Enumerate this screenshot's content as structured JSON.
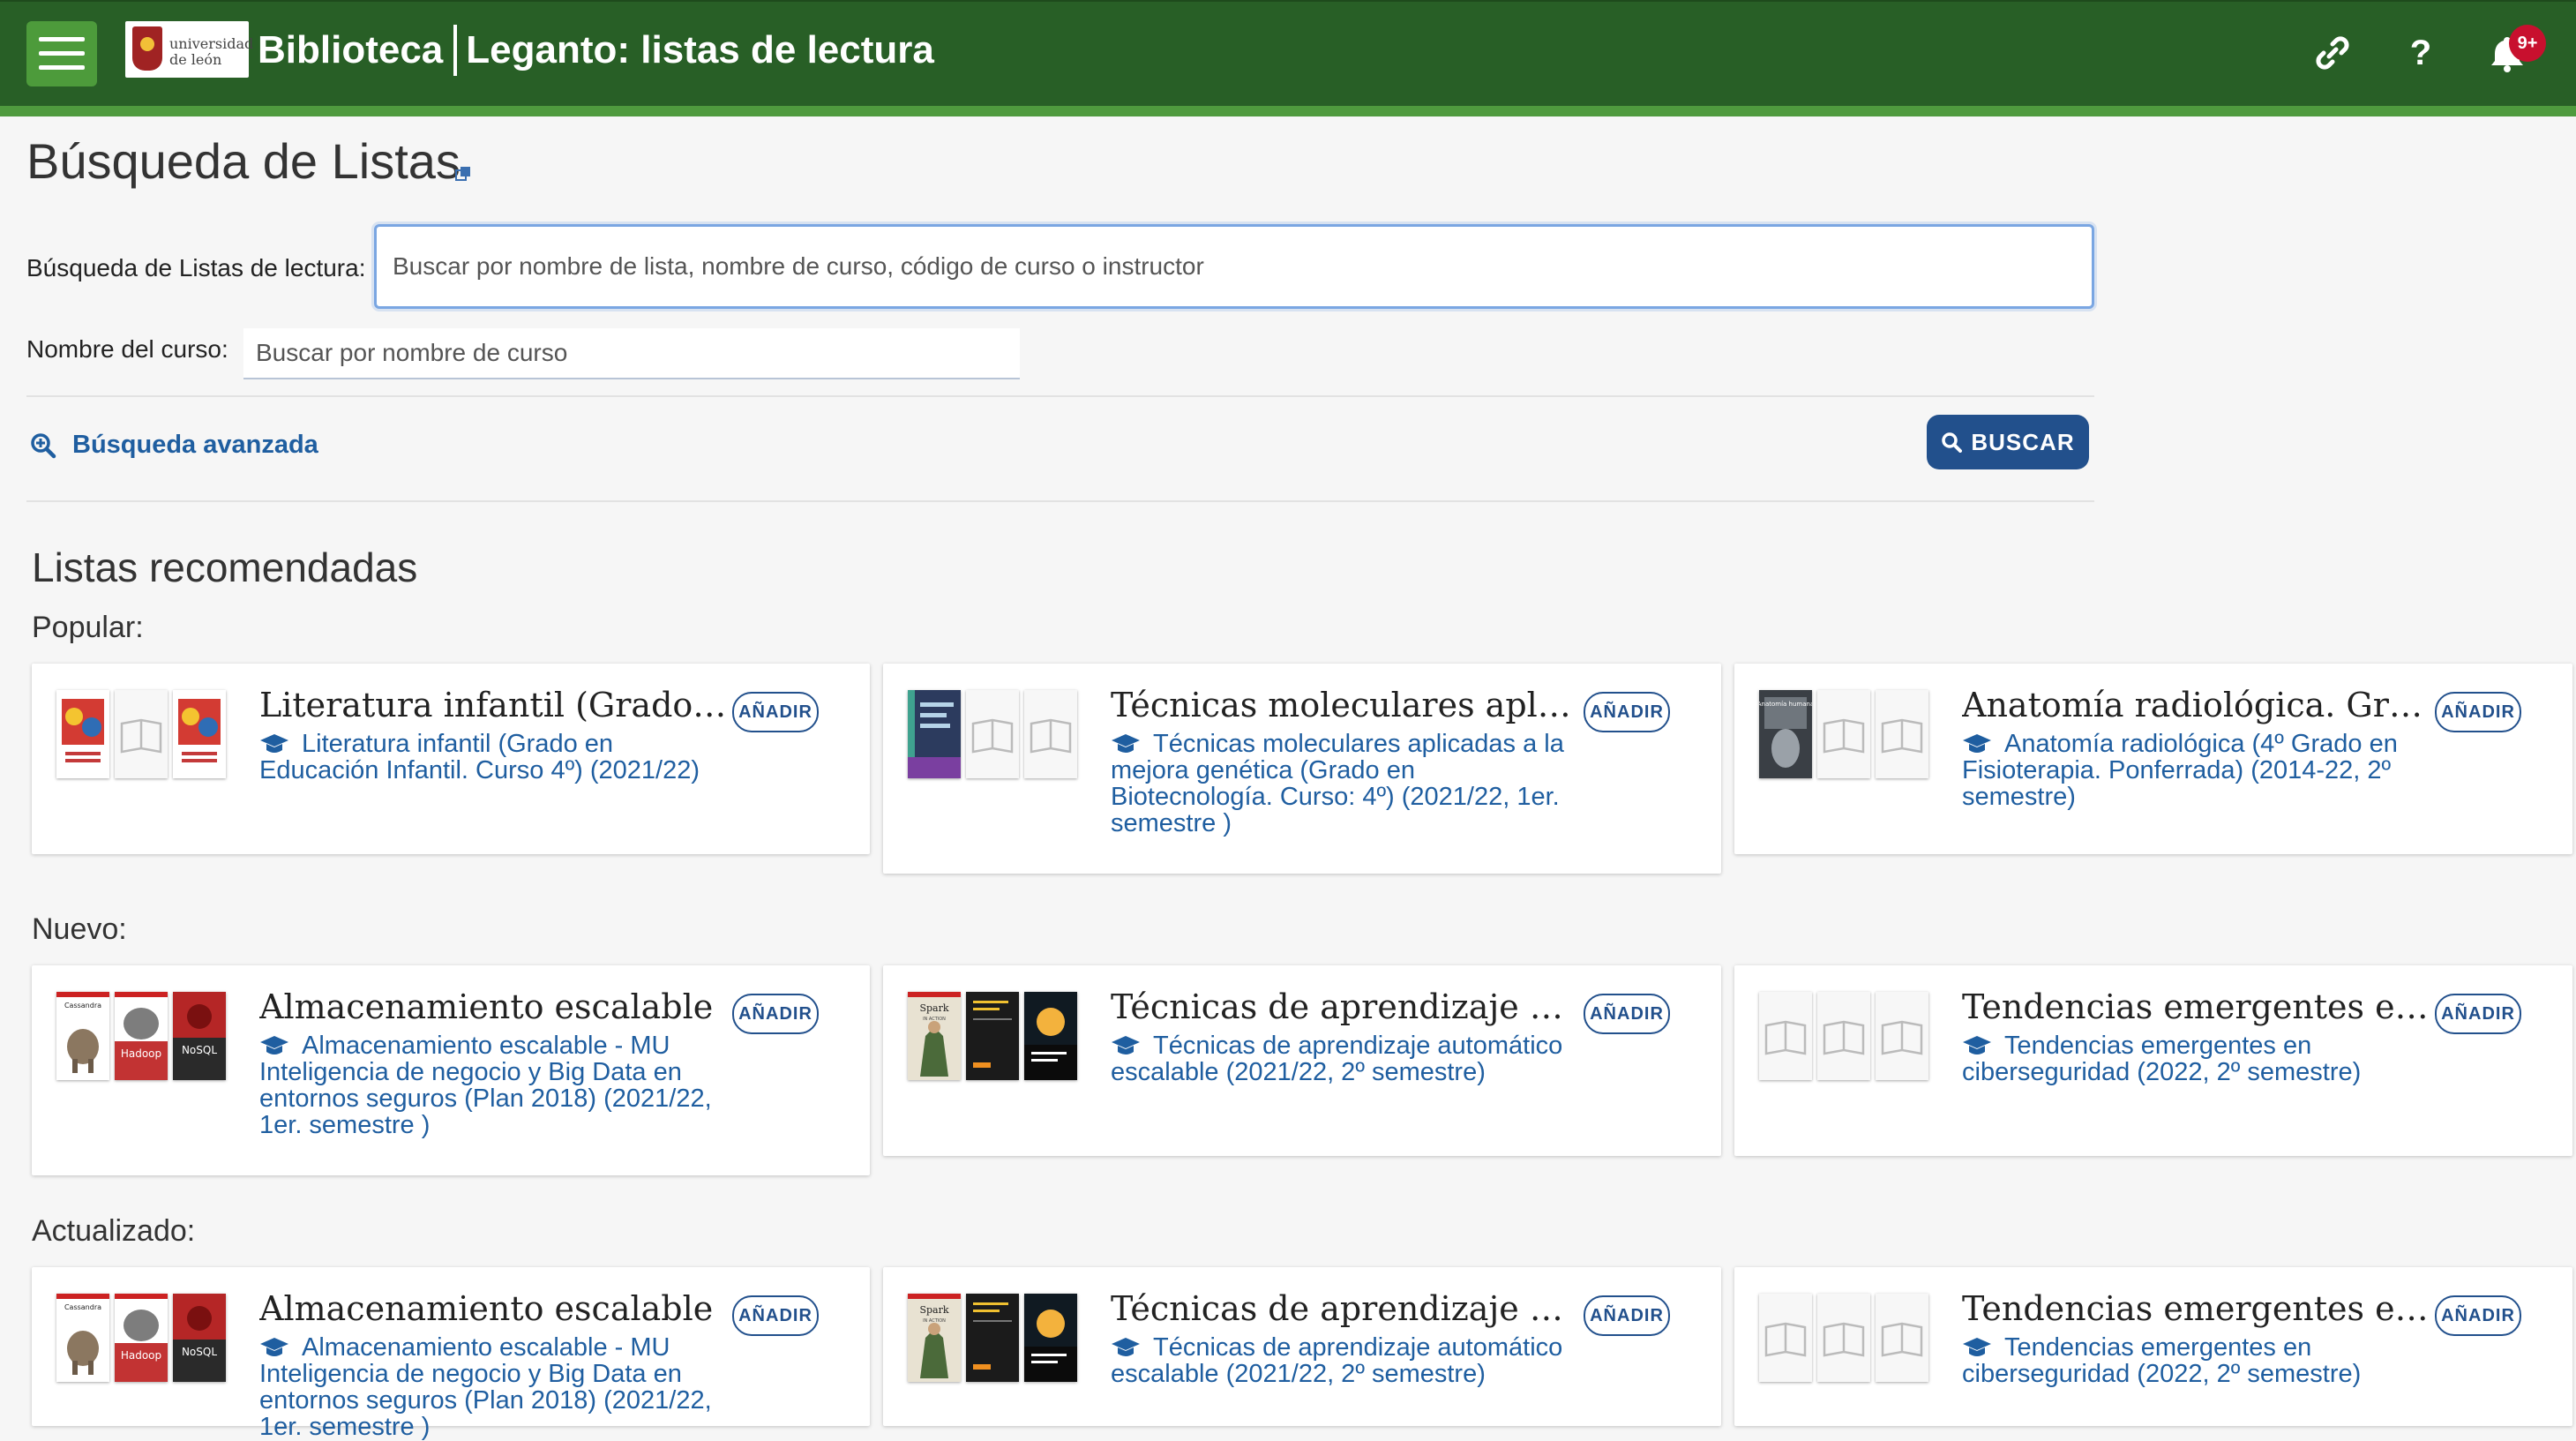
{
  "header": {
    "logo_line1": "universidad",
    "logo_line2": "de león",
    "brand_left": "Biblioteca",
    "brand_right": "Leganto: listas de lectura",
    "notification_badge": "9+",
    "help_label": "?",
    "icons": [
      "hamburger-menu-icon",
      "link-icon",
      "help-icon",
      "bell-icon"
    ],
    "colors": {
      "header_bg": "#285f26",
      "header_stripe": "#4f9a3e",
      "accent_blue": "#22508c",
      "badge": "#c8102e"
    }
  },
  "search": {
    "page_title": "Búsqueda de Listas",
    "reading_list_label": "Búsqueda de Listas de lectura:",
    "reading_list_placeholder": "Buscar por nombre de lista, nombre de curso, código de curso o instructor",
    "course_label": "Nombre del curso:",
    "course_placeholder": "Buscar por nombre de curso",
    "advanced_label": "Búsqueda avanzada",
    "search_button": "BUSCAR"
  },
  "recommended": {
    "title": "Listas recomendadas",
    "add_label": "AÑADIR",
    "sections": [
      {
        "label": "Popular:",
        "cards": [
          {
            "title": "Literatura infantil (Grado e...",
            "subtitle": "Literatura infantil (Grado en Educación Infantil. Curso 4º) (2021/22)"
          },
          {
            "title": "Técnicas moleculares aplic...",
            "subtitle": "Técnicas moleculares aplicadas a la mejora genética (Grado en Biotecnología. Curso: 4º) (2021/22, 1er. semestre )"
          },
          {
            "title": "Anatomía radiológica. Gra...",
            "subtitle": "Anatomía radiológica (4º Grado en Fisioterapia. Ponferrada) (2014-22, 2º semestre)"
          }
        ]
      },
      {
        "label": "Nuevo:",
        "cards": [
          {
            "title": "Almacenamiento escalable",
            "subtitle": "Almacenamiento escalable - MU Inteligencia de negocio y Big Data en entornos seguros (Plan 2018) (2021/22, 1er. semestre )"
          },
          {
            "title": "Técnicas de aprendizaje aut...",
            "subtitle": "Técnicas de aprendizaje automático escalable (2021/22, 2º semestre)"
          },
          {
            "title": "Tendencias emergentes en ...",
            "subtitle": "Tendencias emergentes en ciberseguridad (2022, 2º semestre)"
          }
        ]
      },
      {
        "label": "Actualizado:",
        "cards": [
          {
            "title": "Almacenamiento escalable",
            "subtitle": "Almacenamiento escalable - MU Inteligencia de negocio y Big Data en entornos seguros (Plan 2018) (2021/22, 1er. semestre )"
          },
          {
            "title": "Técnicas de aprendizaje aut...",
            "subtitle": "Técnicas de aprendizaje automático escalable (2021/22, 2º semestre)"
          },
          {
            "title": "Tendencias emergentes en ...",
            "subtitle": "Tendencias emergentes en ciberseguridad (2022, 2º semestre)"
          }
        ]
      }
    ]
  },
  "book_cover_texts": {
    "cassandra": "Cassandra",
    "hadoop": "Hadoop",
    "nosql": "NoSQL",
    "spark": "Spark",
    "spark_subtitle": "IN ACTION",
    "anatomia": "Anatomía humana"
  }
}
